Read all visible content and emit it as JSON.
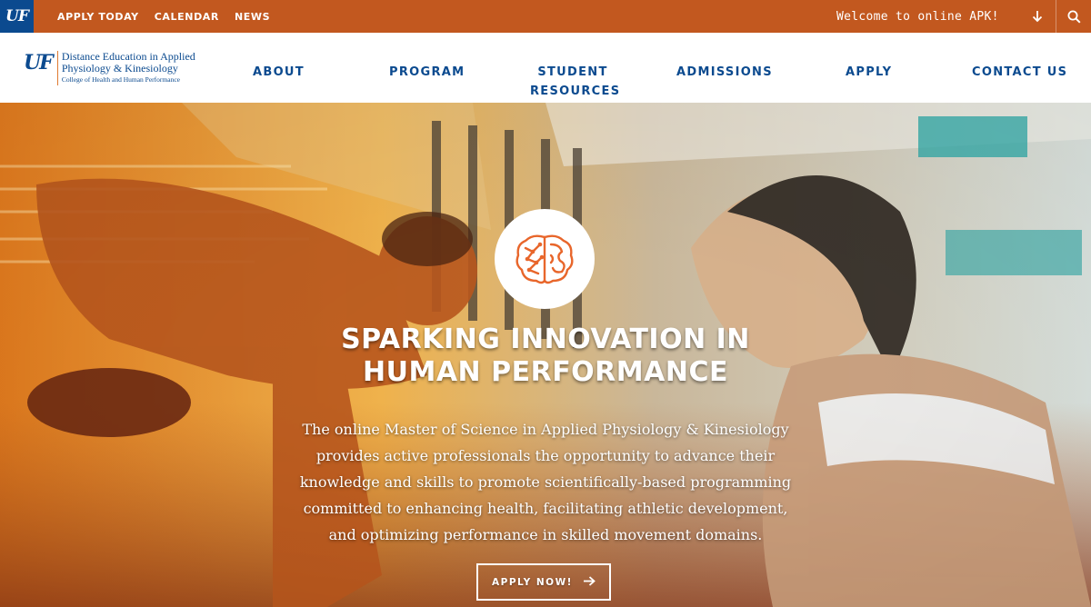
{
  "topbar": {
    "badge": "UF",
    "links": [
      "APPLY TODAY",
      "CALENDAR",
      "NEWS"
    ],
    "welcome": "Welcome to online APK!",
    "toggle_icon": "arrow-down-icon",
    "search_icon": "search-icon"
  },
  "logo": {
    "mark": "UF",
    "line1": "Distance Education in Applied",
    "line2": "Physiology & Kinesiology",
    "line3": "College of Health and Human Performance"
  },
  "nav": {
    "about": "ABOUT",
    "program": "PROGRAM",
    "student_resources_1": "STUDENT",
    "student_resources_2": "RESOURCES",
    "admissions": "ADMISSIONS",
    "apply": "APPLY",
    "contact": "CONTACT US"
  },
  "hero": {
    "icon": "brain-icon",
    "title_1": "SPARKING INNOVATION IN",
    "title_2": "HUMAN PERFORMANCE",
    "text_1": "The online Master of Science in Applied Physiology & Kinesiology",
    "text_2": "provides active professionals the opportunity to advance their",
    "text_3": "knowledge and skills to promote scientifically-based programming",
    "text_4": "committed to enhancing health, facilitating athletic development,",
    "text_5": "and optimizing performance in skilled movement domains.",
    "button": "APPLY NOW!"
  },
  "colors": {
    "topbar": "#c2581f",
    "brand_blue": "#0b4a8f",
    "accent_orange": "#e8662b"
  }
}
